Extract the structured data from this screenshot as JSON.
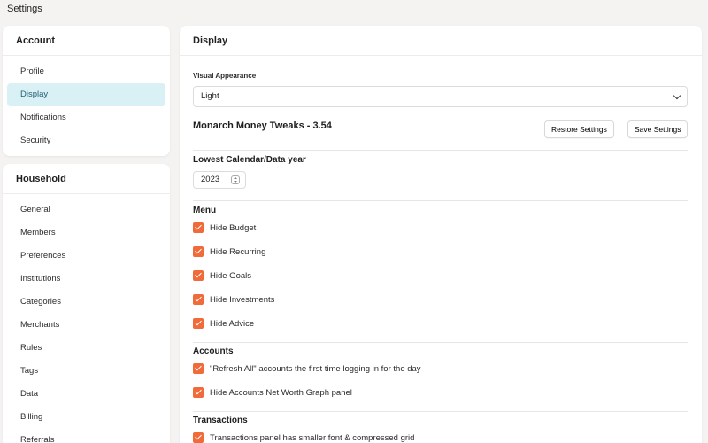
{
  "page": {
    "title": "Settings"
  },
  "account": {
    "title": "Account",
    "items": [
      {
        "label": "Profile"
      },
      {
        "label": "Display"
      },
      {
        "label": "Notifications"
      },
      {
        "label": "Security"
      }
    ],
    "active": "Display"
  },
  "household": {
    "title": "Household",
    "items": [
      {
        "label": "General"
      },
      {
        "label": "Members"
      },
      {
        "label": "Preferences"
      },
      {
        "label": "Institutions"
      },
      {
        "label": "Categories"
      },
      {
        "label": "Merchants"
      },
      {
        "label": "Rules"
      },
      {
        "label": "Tags"
      },
      {
        "label": "Data"
      },
      {
        "label": "Billing"
      },
      {
        "label": "Referrals"
      }
    ]
  },
  "display": {
    "title": "Display",
    "visual_appearance_label": "Visual Appearance",
    "visual_appearance_value": "Light",
    "tweaks_title": "Monarch Money Tweaks - 3.54",
    "restore_label": "Restore Settings",
    "save_label": "Save Settings",
    "lowest_year_label": "Lowest Calendar/Data year",
    "lowest_year_value": "2023",
    "menu": {
      "title": "Menu",
      "items": [
        {
          "label": "Hide Budget",
          "checked": true
        },
        {
          "label": "Hide Recurring",
          "checked": true
        },
        {
          "label": "Hide Goals",
          "checked": true
        },
        {
          "label": "Hide Investments",
          "checked": true
        },
        {
          "label": "Hide Advice",
          "checked": true
        }
      ]
    },
    "accounts": {
      "title": "Accounts",
      "items": [
        {
          "label": "\"Refresh All\" accounts the first time logging in for the day",
          "checked": true
        },
        {
          "label": "Hide Accounts Net Worth Graph panel",
          "checked": true
        }
      ]
    },
    "transactions": {
      "title": "Transactions",
      "items": [
        {
          "label": "Transactions panel has smaller font & compressed grid",
          "checked": true
        }
      ]
    }
  },
  "colors": {
    "accent": "#f06a3a",
    "active_bg": "#d9f0f4",
    "active_text": "#1d5f73"
  }
}
